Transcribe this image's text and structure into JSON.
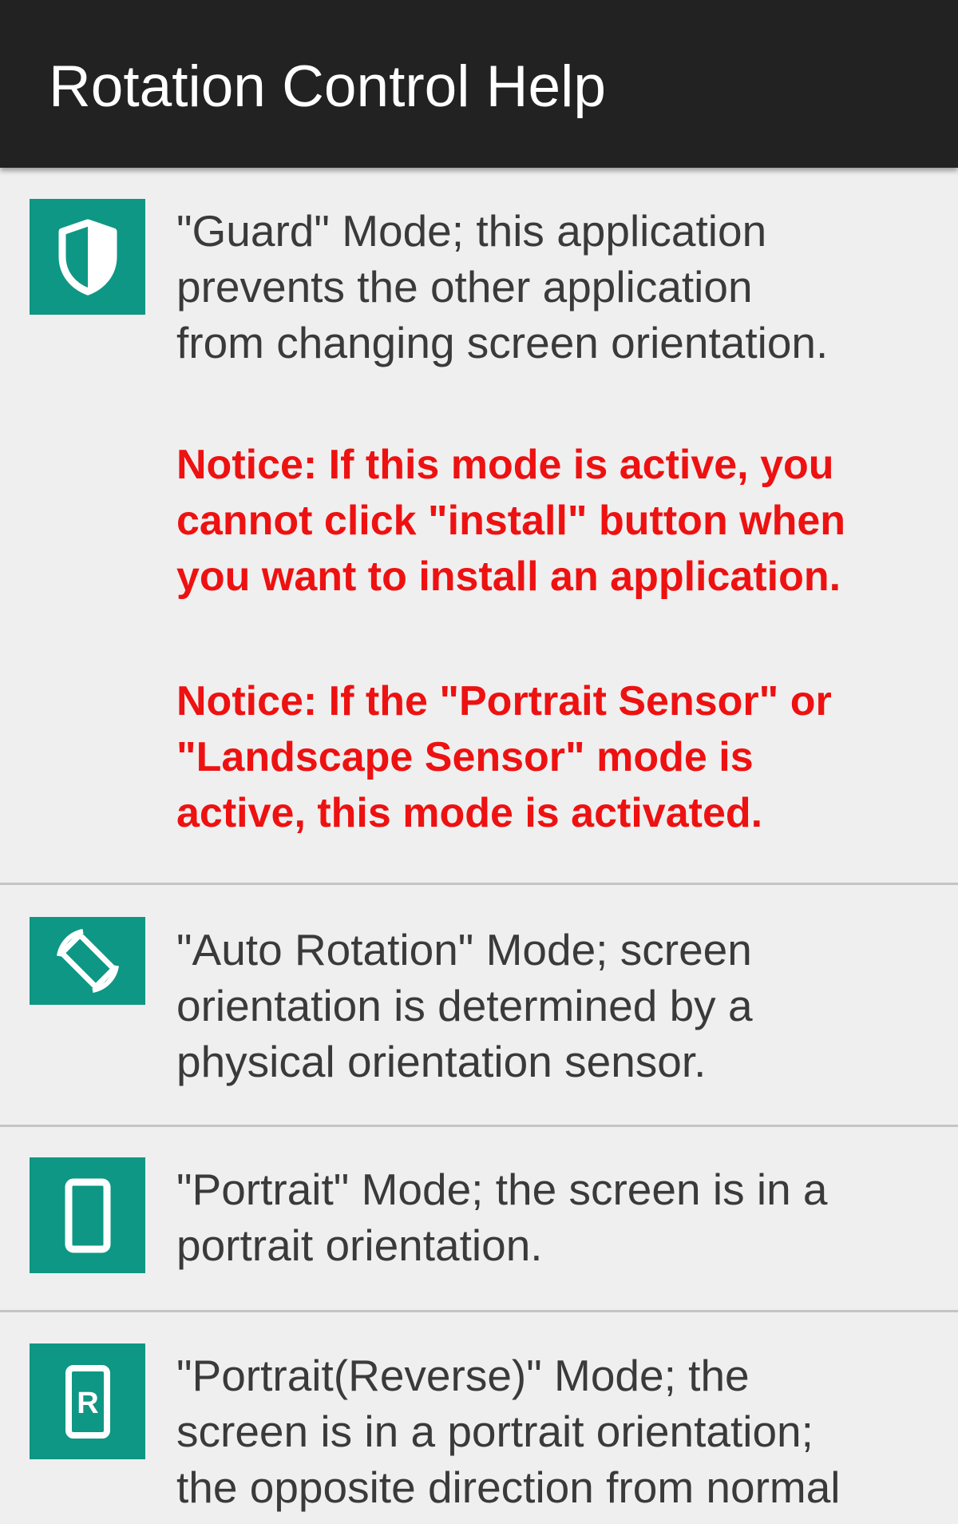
{
  "app_bar": {
    "title": "Rotation Control Help"
  },
  "colors": {
    "app_bar_bg": "#222222",
    "icon_bg": "#0e9784",
    "notice_text": "#ee1111",
    "body_text": "#3a3a3a",
    "page_bg": "#efefef"
  },
  "items": [
    {
      "icon": "shield-icon",
      "description_lines": [
        "\"Guard\" Mode; this application",
        "prevents the other application",
        "from changing screen orientation."
      ],
      "notices": [
        {
          "lines": [
            "Notice: If this mode is active, you",
            "cannot click \"install\" button when",
            "you want to install an application."
          ]
        },
        {
          "lines": [
            "Notice: If the \"Portrait Sensor\" or",
            "\"Landscape Sensor\" mode is",
            "active, this mode is activated."
          ]
        }
      ]
    },
    {
      "icon": "auto-rotate-icon",
      "description_lines": [
        "\"Auto Rotation\" Mode; screen",
        "orientation is determined by a",
        "physical orientation sensor."
      ]
    },
    {
      "icon": "portrait-phone-icon",
      "description_lines": [
        "\"Portrait\" Mode; the screen is in a",
        "portrait orientation."
      ]
    },
    {
      "icon": "portrait-reverse-icon",
      "icon_letter": "R",
      "description_lines": [
        "\"Portrait(Reverse)\" Mode; the",
        "screen is in a portrait orientation;",
        "the opposite direction from normal"
      ]
    }
  ]
}
